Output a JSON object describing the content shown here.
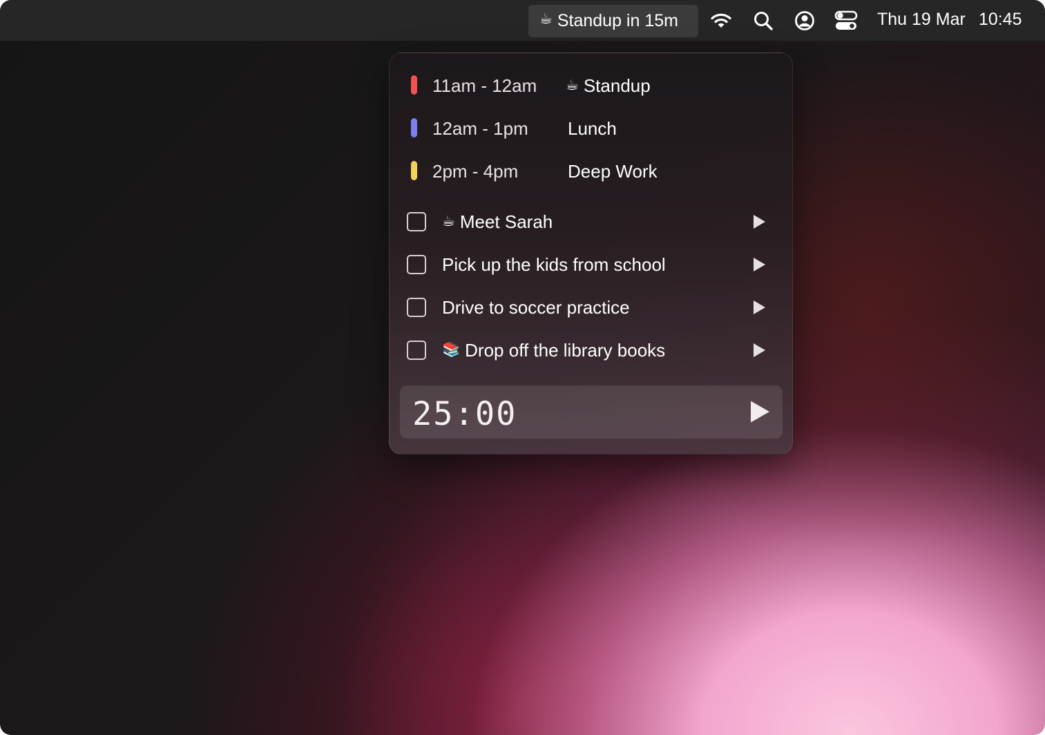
{
  "menubar": {
    "status_emoji": "☕",
    "status_text": "Standup in 15m",
    "icons": [
      "wifi-icon",
      "search-icon",
      "user-circle-icon",
      "control-center-icon"
    ],
    "date": "Thu 19 Mar",
    "time": "10:45"
  },
  "events": [
    {
      "time": "11am - 12am",
      "emoji": "☕",
      "title": "Standup",
      "color": "#ef5350"
    },
    {
      "time": "12am - 1pm",
      "emoji": "",
      "title": "Lunch",
      "color": "#7b7ff0"
    },
    {
      "time": "2pm - 4pm",
      "emoji": "",
      "title": "Deep Work",
      "color": "#f3d25a"
    }
  ],
  "tasks": [
    {
      "emoji": "☕",
      "label": "Meet Sarah"
    },
    {
      "emoji": "",
      "label": "Pick up the kids from school"
    },
    {
      "emoji": "",
      "label": "Drive to soccer practice"
    },
    {
      "emoji": "📚",
      "label": "Drop off the library books"
    }
  ],
  "timer": {
    "value": "25:00"
  }
}
